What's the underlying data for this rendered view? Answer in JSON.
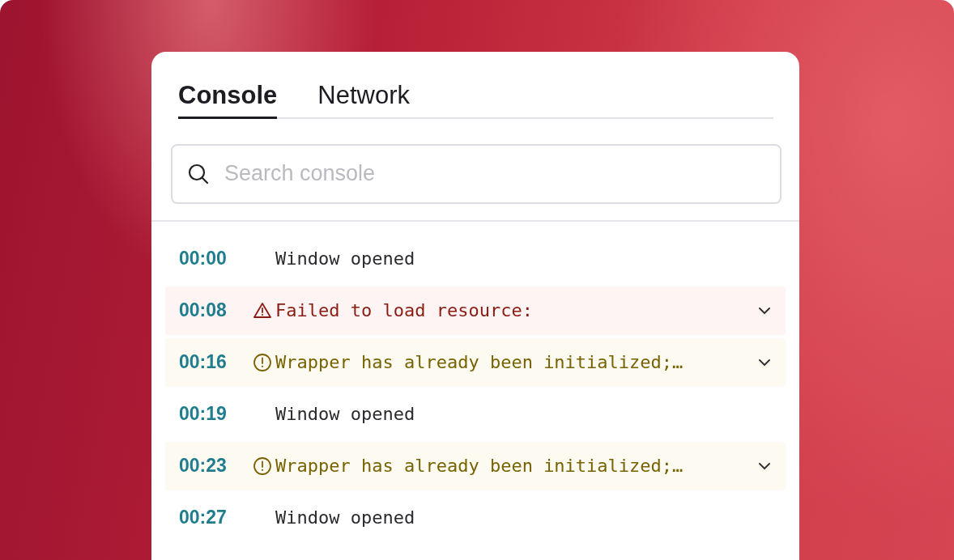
{
  "tabs": [
    {
      "label": "Console",
      "selected": true
    },
    {
      "label": "Network",
      "selected": false
    }
  ],
  "search": {
    "placeholder": "Search console"
  },
  "rows": [
    {
      "time": "00:00",
      "kind": "info",
      "message": "Window opened",
      "expandable": false
    },
    {
      "time": "00:08",
      "kind": "error",
      "message": "Failed to load resource:",
      "expandable": true
    },
    {
      "time": "00:16",
      "kind": "warning",
      "message": "Wrapper has already been initialized;…",
      "expandable": true
    },
    {
      "time": "00:19",
      "kind": "info",
      "message": "Window opened",
      "expandable": false
    },
    {
      "time": "00:23",
      "kind": "warning",
      "message": "Wrapper has already been initialized;…",
      "expandable": true
    },
    {
      "time": "00:27",
      "kind": "info",
      "message": "Window opened",
      "expandable": false
    }
  ]
}
